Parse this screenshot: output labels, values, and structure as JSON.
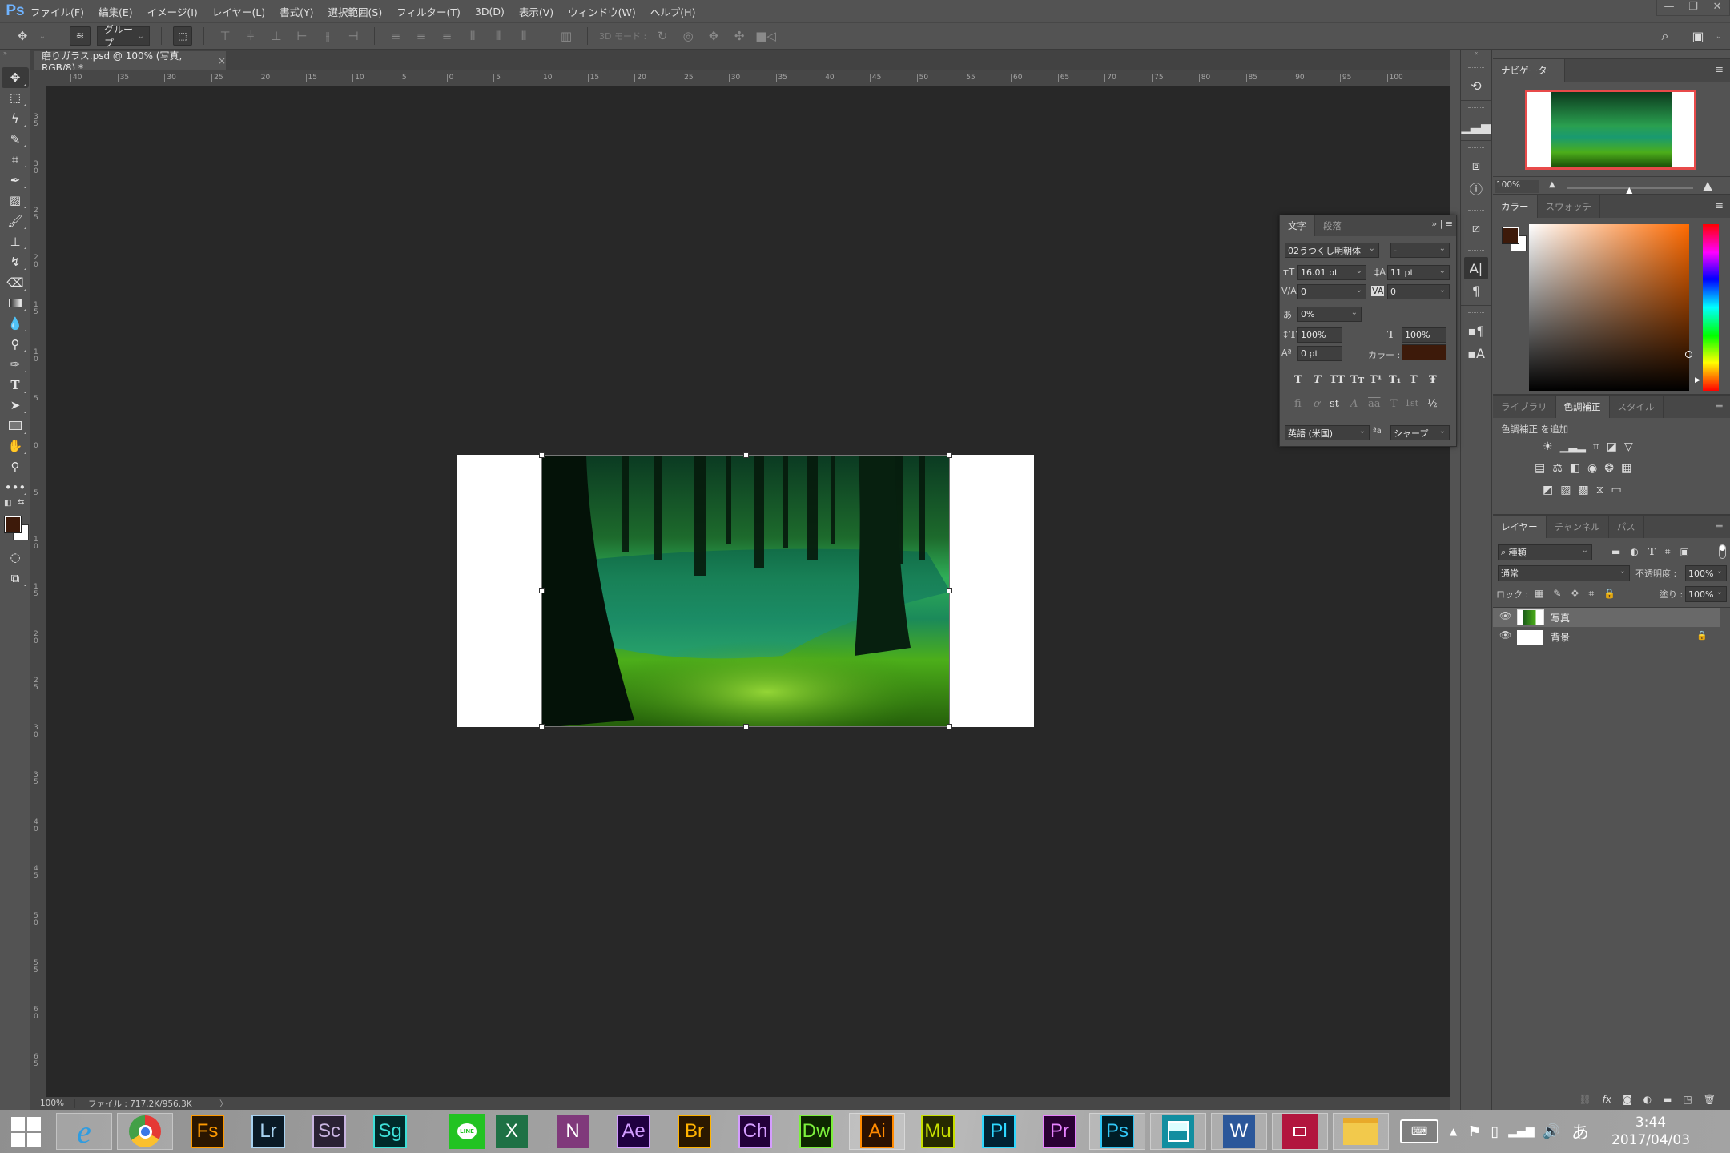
{
  "app": {
    "logo": "Ps"
  },
  "menu": [
    "ファイル(F)",
    "編集(E)",
    "イメージ(I)",
    "レイヤー(L)",
    "書式(Y)",
    "選択範囲(S)",
    "フィルター(T)",
    "3D(D)",
    "表示(V)",
    "ウィンドウ(W)",
    "ヘルプ(H)"
  ],
  "window_controls": {
    "minimize": "—",
    "restore": "❐",
    "close": "✕"
  },
  "options_bar": {
    "auto_select_target": "グループ",
    "mode_3d_label": "3D モード :"
  },
  "document_tab": {
    "title": "磨りガラス.psd @ 100% (写真, RGB/8) *",
    "close": "×"
  },
  "rulers": {
    "horizontal": [
      "40",
      "35",
      "30",
      "25",
      "20",
      "15",
      "10",
      "5",
      "0",
      "5",
      "10",
      "15",
      "20",
      "25",
      "30",
      "35",
      "40",
      "45",
      "50",
      "55",
      "60",
      "65",
      "70",
      "75",
      "80",
      "85",
      "90",
      "95",
      "100"
    ],
    "vertical": [
      "3 5",
      "3 0",
      "2 5",
      "2 0",
      "1 5",
      "1 0",
      "5",
      "0",
      "5",
      "1 0",
      "1 5",
      "2 0",
      "2 5",
      "3 0",
      "3 5",
      "4 0",
      "4 5",
      "5 0",
      "5 5",
      "6 0",
      "6 5"
    ]
  },
  "status_bar": {
    "zoom": "100%",
    "file_info": "ファイル : 717.2K/956.3K",
    "arrow": "〉"
  },
  "colors": {
    "foreground": "#3d1a0a",
    "background": "#ffffff",
    "char_color": "#3d1a0a",
    "nav_frame": "#e84a4a"
  },
  "navigator": {
    "tab": "ナビゲーター",
    "zoom": "100%",
    "zoom_slider_fraction": 0.5
  },
  "color_panel": {
    "tabs": [
      "カラー",
      "スウォッチ"
    ],
    "active": 0
  },
  "adjust_panel": {
    "tabs": [
      "ライブラリ",
      "色調補正",
      "スタイル"
    ],
    "active": 1,
    "heading": "色調補正 を追加"
  },
  "layers_panel": {
    "tabs": [
      "レイヤー",
      "チャンネル",
      "パス"
    ],
    "filter_kind": "種類",
    "blend_mode": "通常",
    "opacity_label": "不透明度 :",
    "opacity": "100%",
    "lock_label": "ロック :",
    "fill_label": "塗り :",
    "fill": "100%",
    "layers": [
      {
        "name": "写真",
        "visible": true,
        "selected": true,
        "smart_object": true
      },
      {
        "name": "背景",
        "visible": true,
        "selected": false,
        "locked": true
      }
    ]
  },
  "character_panel": {
    "tabs": [
      "文字",
      "段落"
    ],
    "font_family": "02うつくし明朝体",
    "font_style": "-",
    "font_size": "16.01 pt",
    "leading": "11 pt",
    "kerning": "0",
    "tracking": "0",
    "tsume": "0%",
    "vertical_scale": "100%",
    "horizontal_scale": "100%",
    "baseline_shift": "0 pt",
    "color_label": "カラー :",
    "type_styles": [
      "T",
      "T",
      "TT",
      "Tт",
      "T¹",
      "T₁",
      "T",
      "Ŧ"
    ],
    "opentype": [
      "fi",
      "ơ",
      "st",
      "A",
      "aa",
      "T",
      "1st",
      "½"
    ],
    "language": "英語 (米国)",
    "aa_icon": "ªa",
    "antialias": "シャープ"
  },
  "taskbar": {
    "apps": [
      {
        "label": "Fs",
        "fg": "#ff9a00",
        "bg": "#2b1600"
      },
      {
        "label": "Lr",
        "fg": "#a8d2f0",
        "bg": "#0a1a26"
      },
      {
        "label": "Sc",
        "fg": "#c8b4e0",
        "bg": "#2a2134"
      },
      {
        "label": "Sg",
        "fg": "#3ee0d8",
        "bg": "#002a2a"
      },
      {
        "label": "Ae",
        "fg": "#d19cff",
        "bg": "#1f0040"
      },
      {
        "label": "Br",
        "fg": "#ffb300",
        "bg": "#2a1800"
      },
      {
        "label": "Ch",
        "fg": "#d49cff",
        "bg": "#23003a"
      },
      {
        "label": "Dw",
        "fg": "#7cf03c",
        "bg": "#0d2600"
      },
      {
        "label": "Ai",
        "fg": "#ff8a00",
        "bg": "#2b1100"
      },
      {
        "label": "Mu",
        "fg": "#c8e000",
        "bg": "#262a00"
      },
      {
        "label": "Pl",
        "fg": "#2fd8ff",
        "bg": "#002233"
      },
      {
        "label": "Pr",
        "fg": "#e882ff",
        "bg": "#2a0033"
      },
      {
        "label": "Ps",
        "fg": "#31c5f4",
        "bg": "#001d26"
      }
    ],
    "time": "3:44",
    "date": "2017/04/03",
    "ime": "あ"
  }
}
